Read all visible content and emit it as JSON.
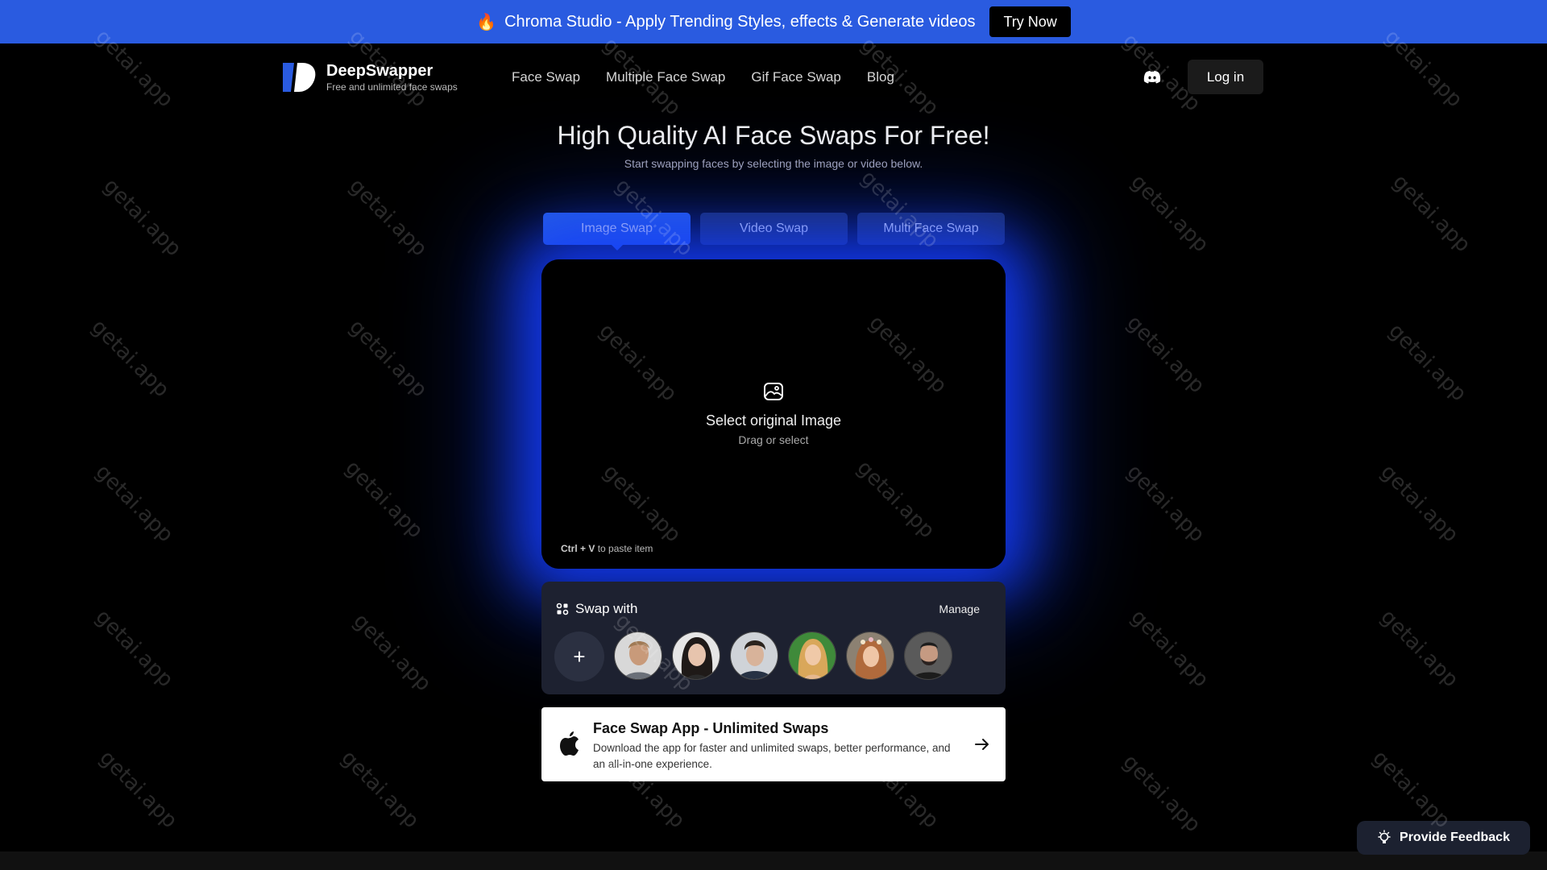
{
  "banner": {
    "emoji": "🔥",
    "text": "Chroma Studio - Apply Trending Styles, effects & Generate videos",
    "button": "Try Now",
    "color": "#2a5be0"
  },
  "nav": {
    "brand": "DeepSwapper",
    "tagline": "Free and unlimited face swaps",
    "links": [
      "Face Swap",
      "Multiple Face Swap",
      "Gif Face Swap",
      "Blog"
    ],
    "discord_icon": "discord-icon",
    "login": "Log in"
  },
  "hero": {
    "title": "High Quality AI Face Swaps For Free!",
    "subtitle": "Start swapping faces by selecting the image or video below."
  },
  "tabs": [
    {
      "label": "Image Swap",
      "active": true
    },
    {
      "label": "Video Swap",
      "active": false
    },
    {
      "label": "Multi Face Swap",
      "active": false
    }
  ],
  "dropzone": {
    "icon": "image-icon",
    "title": "Select original Image",
    "subtitle": "Drag or select",
    "paste_keys": "Ctrl + V",
    "paste_text": "to paste item"
  },
  "swap_with": {
    "label": "Swap with",
    "manage": "Manage",
    "add_icon": "+",
    "faces": [
      "face-1",
      "face-2",
      "face-3",
      "face-4",
      "face-5",
      "face-6"
    ]
  },
  "app_card": {
    "icon": "apple-icon",
    "title": "Face Swap App - Unlimited Swaps",
    "description": "Download the app for faster and unlimited swaps, better performance, and an all-in-one experience."
  },
  "feedback": {
    "icon": "lightbulb-icon",
    "label": "Provide Feedback"
  },
  "watermark": "getai.app",
  "colors": {
    "accent": "#2a63e8",
    "tab_inactive": "#1e2d55",
    "glow": "#143cff"
  }
}
